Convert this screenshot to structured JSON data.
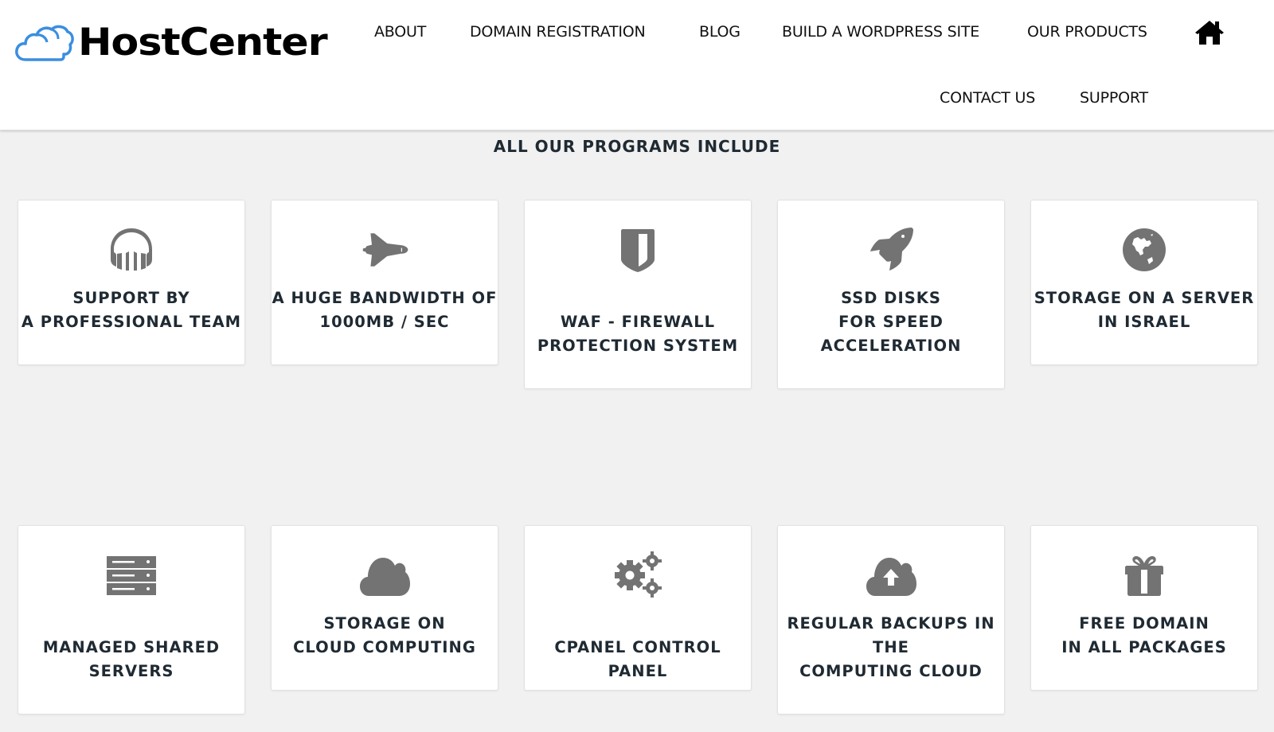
{
  "header": {
    "logo_text": "HostCenter",
    "nav": [
      {
        "label": "ABOUT"
      },
      {
        "label": "DOMAIN REGISTRATION"
      },
      {
        "label": "BLOG"
      },
      {
        "label": "BUILD A WORDPRESS SITE"
      },
      {
        "label": "OUR PRODUCTS"
      },
      {
        "label": "CONTACT US"
      },
      {
        "label": "SUPPORT"
      }
    ],
    "home_icon": "home-icon"
  },
  "section": {
    "title": "ALL OUR PROGRAMS INCLUDE",
    "features": [
      {
        "icon": "headphones-icon",
        "label": "SUPPORT BY\nA PROFESSIONAL TEAM"
      },
      {
        "icon": "space-shuttle-icon",
        "label": "A HUGE BANDWIDTH OF\n1000MB / SEC"
      },
      {
        "icon": "shield-icon",
        "label": "WAF - FIREWALL\nPROTECTION SYSTEM"
      },
      {
        "icon": "rocket-icon",
        "label": "SSD DISKS\nFOR SPEED\nACCELERATION"
      },
      {
        "icon": "globe-icon",
        "label": "STORAGE ON A SERVER\nIN ISRAEL"
      },
      {
        "icon": "server-icon",
        "label": "MANAGED SHARED\nSERVERS"
      },
      {
        "icon": "cloud-icon",
        "label": "STORAGE ON\nCLOUD COMPUTING"
      },
      {
        "icon": "gears-icon",
        "label": "CPANEL CONTROL PANEL"
      },
      {
        "icon": "cloud-upload-icon",
        "label": "REGULAR BACKUPS IN\nTHE\nCOMPUTING CLOUD"
      },
      {
        "icon": "gift-icon",
        "label": "FREE DOMAIN\nIN ALL PACKAGES"
      }
    ]
  },
  "colors": {
    "background": "#f1f1f1",
    "icon": "#737373",
    "text": "#1f2a33",
    "logo_cloud": "#3a8ee0"
  }
}
